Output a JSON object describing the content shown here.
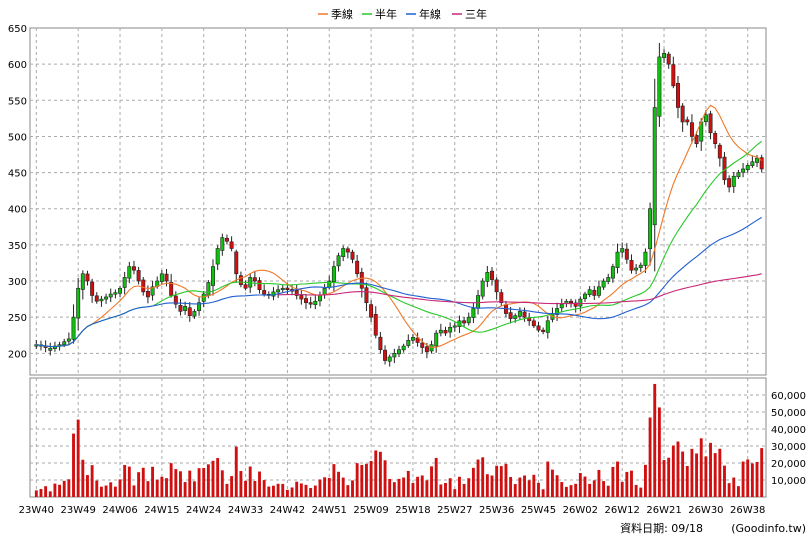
{
  "chart_data": {
    "type": "candlestick",
    "legend": [
      {
        "name": "季線",
        "color": "#f07828"
      },
      {
        "name": "半年",
        "color": "#28c828"
      },
      {
        "name": "年線",
        "color": "#2060d0"
      },
      {
        "name": "三年",
        "color": "#c82878"
      }
    ],
    "price_axis": {
      "ylim": [
        170,
        650
      ],
      "ticks": [
        200,
        250,
        300,
        350,
        400,
        450,
        500,
        550,
        600,
        650
      ]
    },
    "volume_axis": {
      "ylim": [
        0,
        70000
      ],
      "ticks": [
        10000,
        20000,
        30000,
        40000,
        50000,
        60000
      ],
      "tick_labels": [
        "10,000",
        "20,000",
        "30,000",
        "40,000",
        "50,000",
        "60,000"
      ]
    },
    "x_labels": [
      "23W40",
      "23W49",
      "24W06",
      "24W15",
      "24W24",
      "24W33",
      "24W42",
      "24W51",
      "25W09",
      "25W18",
      "25W27",
      "25W36",
      "25W45",
      "26W02",
      "26W12",
      "26W21",
      "26W30",
      "26W38"
    ],
    "label_interval_weeks": 9,
    "grid": true,
    "up_color": "#10c010",
    "down_color": "#d01010",
    "volume_color": "#d01010",
    "close": [
      212,
      210,
      208,
      207,
      210,
      212,
      216,
      220,
      250,
      290,
      310,
      300,
      280,
      272,
      275,
      278,
      282,
      284,
      290,
      305,
      320,
      315,
      300,
      285,
      278,
      292,
      300,
      310,
      300,
      280,
      268,
      258,
      265,
      252,
      258,
      270,
      282,
      298,
      320,
      345,
      360,
      355,
      345,
      310,
      295,
      290,
      305,
      300,
      288,
      282,
      280,
      285,
      288,
      290,
      288,
      286,
      280,
      275,
      270,
      268,
      272,
      280,
      290,
      300,
      320,
      335,
      345,
      340,
      330,
      310,
      290,
      270,
      250,
      225,
      205,
      190,
      195,
      200,
      205,
      210,
      218,
      222,
      215,
      208,
      202,
      212,
      228,
      232,
      228,
      236,
      238,
      245,
      242,
      250,
      262,
      280,
      300,
      312,
      302,
      285,
      270,
      255,
      248,
      252,
      258,
      250,
      245,
      238,
      232,
      230,
      245,
      255,
      262,
      268,
      272,
      270,
      265,
      275,
      282,
      288,
      280,
      292,
      300,
      305,
      320,
      340,
      345,
      330,
      315,
      318,
      322,
      340,
      400,
      540,
      610,
      615,
      600,
      570,
      540,
      520,
      520,
      500,
      490,
      520,
      530,
      505,
      490,
      470,
      440,
      430,
      445,
      450,
      455,
      460,
      465,
      470,
      455
    ]
  },
  "footer": {
    "label": "資料日期: 09/18",
    "source": "(Goodinfo.tw)"
  }
}
